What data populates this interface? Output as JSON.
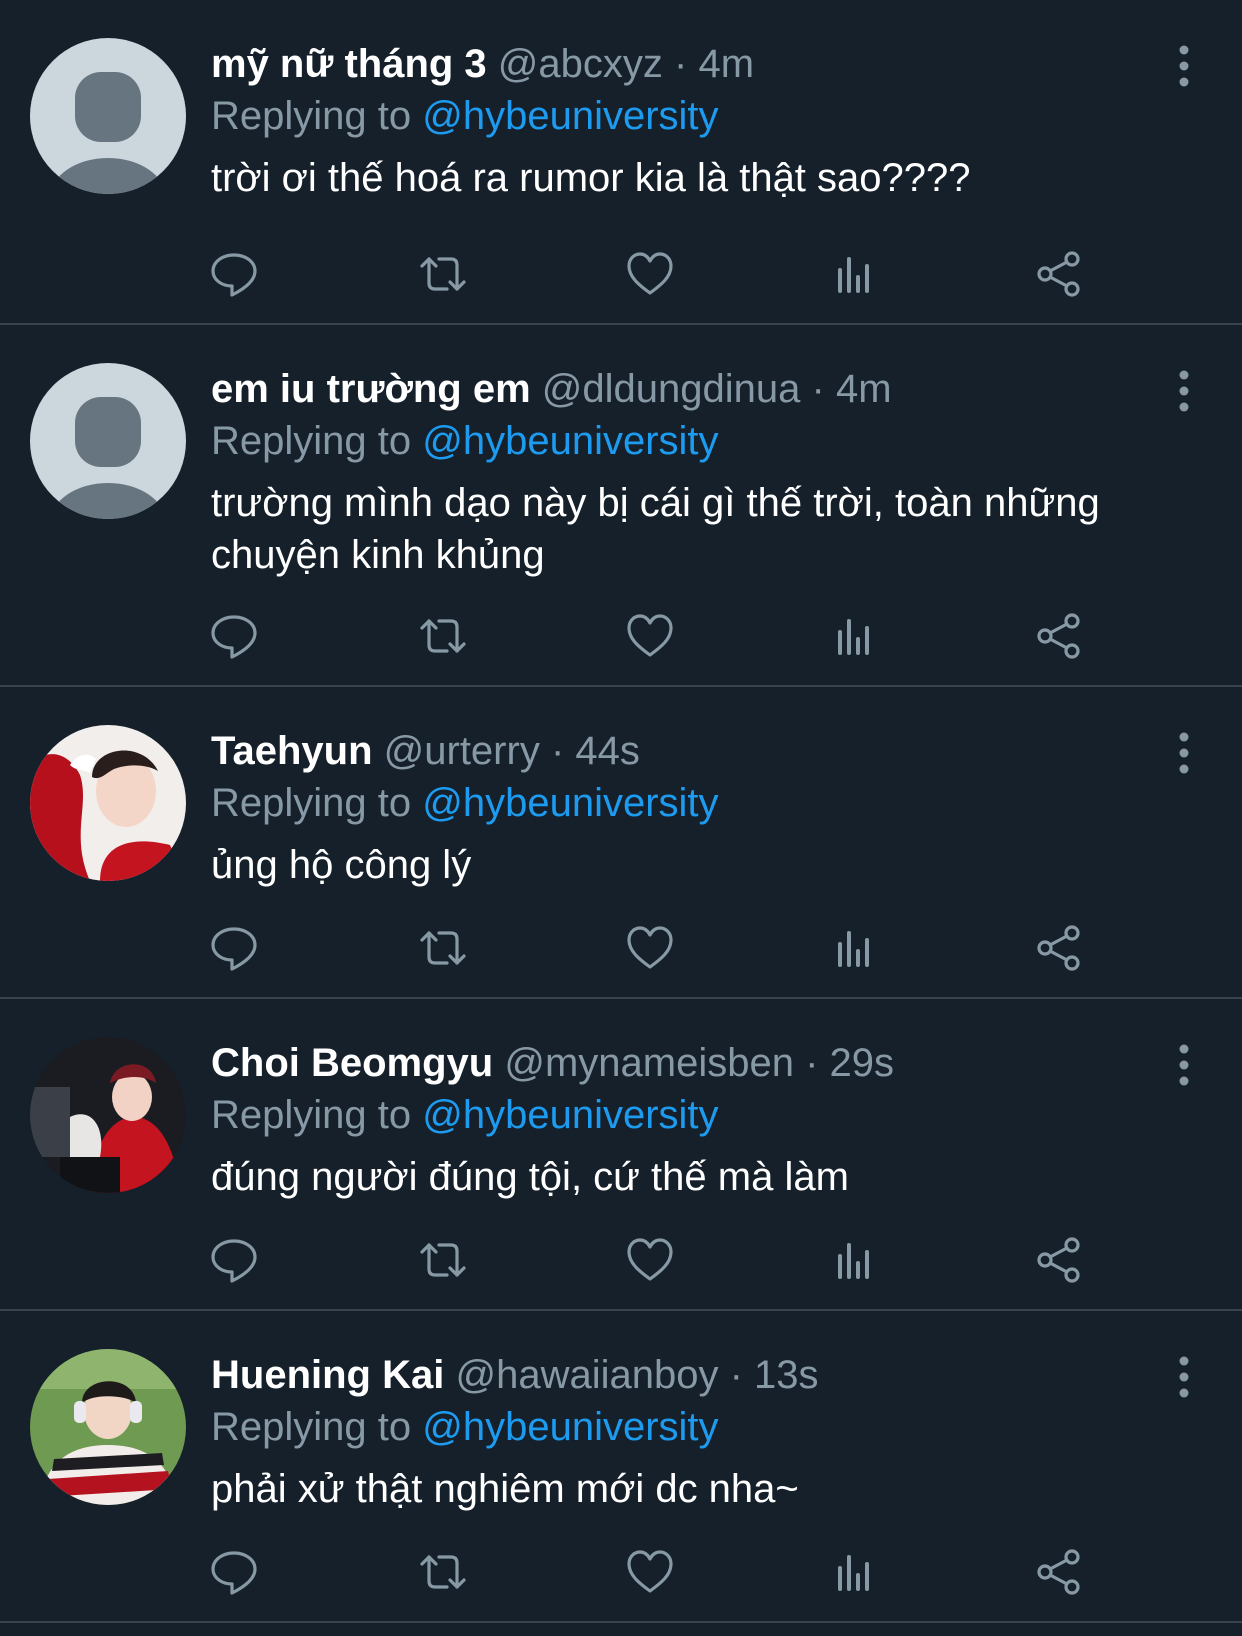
{
  "colors": {
    "background": "#15202b",
    "divider": "#38444d",
    "secondary_text": "#8899a6",
    "accent": "#1d9bf0",
    "icon": "#8899a6"
  },
  "icons": {
    "reply": "reply-icon",
    "retweet": "retweet-icon",
    "like": "like-icon",
    "views": "views-icon",
    "share": "share-icon",
    "more": "more-icon"
  },
  "tweets": [
    {
      "name": "mỹ nữ tháng 3",
      "handle": "@abcxyz",
      "time": "· 4m",
      "replying_label": "Replying to",
      "replying_to": "@hybeuniversity",
      "text": "trời ơi thế hoá ra rumor kia là thật sao????"
    },
    {
      "name": "em iu trường em",
      "handle": "@dldungdinua",
      "time": "· 4m",
      "replying_label": "Replying to",
      "replying_to": "@hybeuniversity",
      "text": "trường mình dạo này bị cái gì thế trời, toàn những chuyện kinh khủng"
    },
    {
      "name": "Taehyun",
      "handle": "@urterry",
      "time": "· 44s",
      "replying_label": "Replying to",
      "replying_to": "@hybeuniversity",
      "text": "ủng hộ công lý"
    },
    {
      "name": "Choi Beomgyu",
      "handle": "@mynameisben",
      "time": "· 29s",
      "replying_label": "Replying to",
      "replying_to": "@hybeuniversity",
      "text": "đúng người đúng tội, cứ thế mà làm"
    },
    {
      "name": "Huening Kai",
      "handle": "@hawaiianboy",
      "time": "· 13s",
      "replying_label": "Replying to",
      "replying_to": "@hybeuniversity",
      "text": "phải xử thật nghiêm mới dc nha~"
    }
  ]
}
